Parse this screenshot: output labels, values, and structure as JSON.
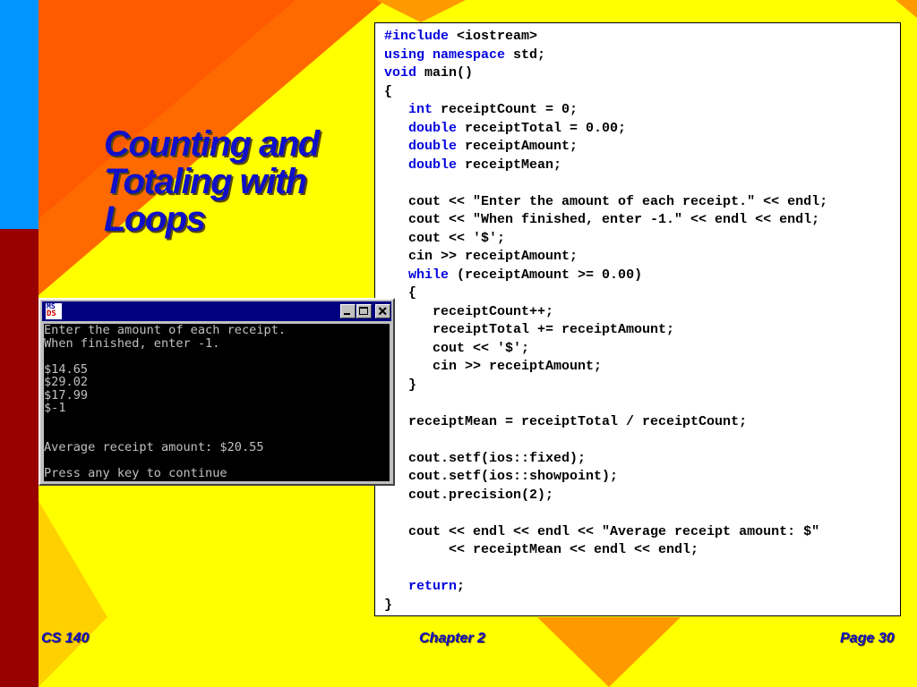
{
  "slide": {
    "title_lines": [
      "Counting and",
      "Totaling with",
      "Loops"
    ],
    "footer": {
      "left": "CS 140",
      "center": "Chapter 2",
      "right": "Page 30"
    },
    "colors": {
      "title": "#1010c8",
      "keyword": "#0000e0",
      "background": "#ffff00"
    }
  },
  "code": {
    "lines": [
      [
        {
          "t": "#include",
          "kw": true
        },
        {
          "t": " <iostream>"
        }
      ],
      [
        {
          "t": "using namespace",
          "kw": true
        },
        {
          "t": " std;"
        }
      ],
      [
        {
          "t": "void",
          "kw": true
        },
        {
          "t": " main()"
        }
      ],
      [
        {
          "t": "{"
        }
      ],
      [
        {
          "t": "   "
        },
        {
          "t": "int",
          "kw": true
        },
        {
          "t": " receiptCount = 0;"
        }
      ],
      [
        {
          "t": "   "
        },
        {
          "t": "double",
          "kw": true
        },
        {
          "t": " receiptTotal = 0.00;"
        }
      ],
      [
        {
          "t": "   "
        },
        {
          "t": "double",
          "kw": true
        },
        {
          "t": " receiptAmount;"
        }
      ],
      [
        {
          "t": "   "
        },
        {
          "t": "double",
          "kw": true
        },
        {
          "t": " receiptMean;"
        }
      ],
      [
        {
          "t": ""
        }
      ],
      [
        {
          "t": "   cout << \"Enter the amount of each receipt.\" << endl;"
        }
      ],
      [
        {
          "t": "   cout << \"When finished, enter -1.\" << endl << endl;"
        }
      ],
      [
        {
          "t": "   cout << '$';"
        }
      ],
      [
        {
          "t": "   cin >> receiptAmount;"
        }
      ],
      [
        {
          "t": "   "
        },
        {
          "t": "while",
          "kw": true
        },
        {
          "t": " (receiptAmount >= 0.00)"
        }
      ],
      [
        {
          "t": "   {"
        }
      ],
      [
        {
          "t": "      receiptCount++;"
        }
      ],
      [
        {
          "t": "      receiptTotal += receiptAmount;"
        }
      ],
      [
        {
          "t": "      cout << '$';"
        }
      ],
      [
        {
          "t": "      cin >> receiptAmount;"
        }
      ],
      [
        {
          "t": "   }"
        }
      ],
      [
        {
          "t": ""
        }
      ],
      [
        {
          "t": "   receiptMean = receiptTotal / receiptCount;"
        }
      ],
      [
        {
          "t": ""
        }
      ],
      [
        {
          "t": "   cout.setf(ios::fixed);"
        }
      ],
      [
        {
          "t": "   cout.setf(ios::showpoint);"
        }
      ],
      [
        {
          "t": "   cout.precision(2);"
        }
      ],
      [
        {
          "t": ""
        }
      ],
      [
        {
          "t": "   cout << endl << endl << \"Average receipt amount: $\""
        }
      ],
      [
        {
          "t": "        << receiptMean << endl << endl;"
        }
      ],
      [
        {
          "t": ""
        }
      ],
      [
        {
          "t": "   "
        },
        {
          "t": "return",
          "kw": true
        },
        {
          "t": ";"
        }
      ],
      [
        {
          "t": "}"
        }
      ]
    ]
  },
  "console": {
    "icon_text_top": "MS",
    "icon_text_bottom": "DS",
    "buttons": [
      "minimize",
      "maximize",
      "close"
    ],
    "lines": [
      "Enter the amount of each receipt.",
      "When finished, enter -1.",
      "",
      "$14.65",
      "$29.02",
      "$17.99",
      "$-1",
      "",
      "",
      "Average receipt amount: $20.55",
      "",
      "Press any key to continue"
    ]
  }
}
